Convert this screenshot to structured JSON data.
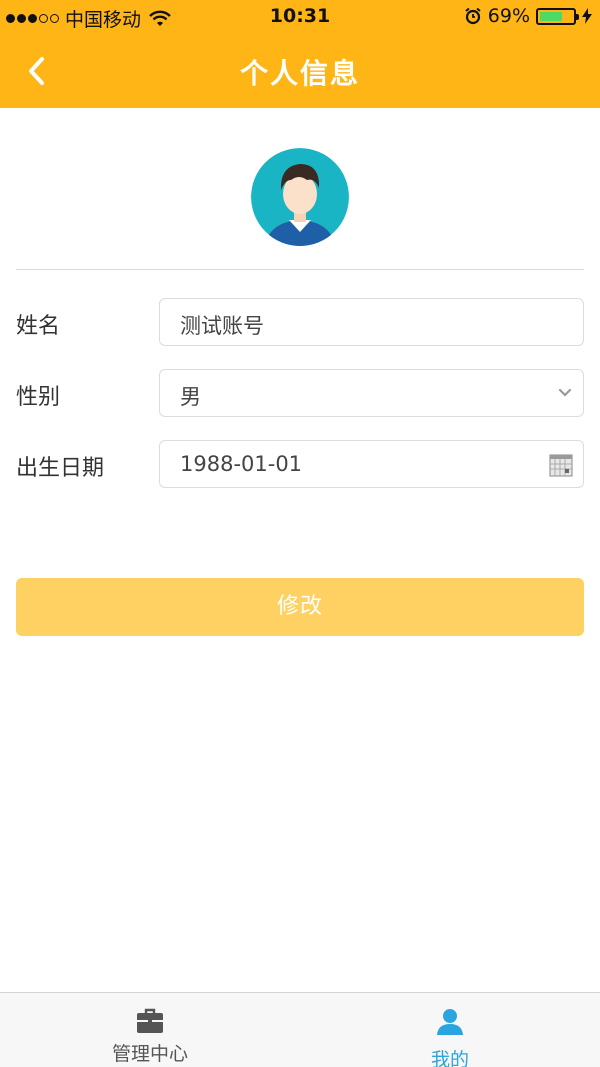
{
  "status_bar": {
    "carrier": "中国移动",
    "time": "10:31",
    "battery_percent": "69%",
    "battery_level": 0.69
  },
  "nav": {
    "title": "个人信息",
    "back_icon": "chevron-left-icon"
  },
  "profile": {
    "avatar_icon": "user-avatar-icon"
  },
  "form": {
    "name": {
      "label": "姓名",
      "value": "测试账号"
    },
    "gender": {
      "label": "性别",
      "value": "男",
      "icon": "chevron-down-icon"
    },
    "birthdate": {
      "label": "出生日期",
      "value": "1988-01-01",
      "icon": "calendar-icon"
    }
  },
  "actions": {
    "submit_label": "修改"
  },
  "tabbar": {
    "items": [
      {
        "label": "管理中心",
        "icon": "briefcase-icon",
        "active": false
      },
      {
        "label": "我的",
        "icon": "person-icon",
        "active": true
      }
    ]
  },
  "colors": {
    "header_bg": "#FFB516",
    "button_bg": "#FFD163",
    "active_tab": "#2aa5e0",
    "avatar_bg": "#1AB5C5"
  }
}
